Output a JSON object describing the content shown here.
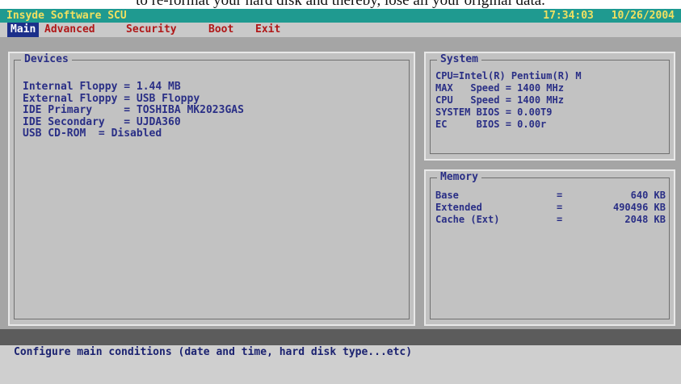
{
  "caption": "to re-format your hard disk and thereby, lose all your original data.",
  "title_bar": {
    "app_name": "Insyde Software SCU",
    "time": "17:34:03",
    "date": "10/26/2004"
  },
  "menu": [
    {
      "label": "Main",
      "active": true
    },
    {
      "label": "Advanced",
      "active": false
    },
    {
      "label": "Security",
      "active": false
    },
    {
      "label": "Boot",
      "active": false
    },
    {
      "label": "Exit",
      "active": false
    }
  ],
  "devices": {
    "title": "Devices",
    "rows": [
      "Internal Floppy = 1.44 MB",
      "External Floppy = USB Floppy",
      "IDE Primary     = TOSHIBA MK2023GAS",
      "IDE Secondary   = UJDA360",
      "USB CD-ROM  = Disabled"
    ]
  },
  "system": {
    "title": "System",
    "rows": [
      "CPU=Intel(R) Pentium(R) M",
      "MAX   Speed = 1400 MHz",
      "CPU   Speed = 1400 MHz",
      "SYSTEM BIOS = 0.00T9",
      "EC     BIOS = 0.00r"
    ]
  },
  "memory": {
    "title": "Memory",
    "rows": [
      {
        "label": "Base",
        "value": "640 KB"
      },
      {
        "label": "Extended",
        "value": "490496 KB"
      },
      {
        "label": "Cache (Ext)",
        "value": "2048 KB"
      }
    ]
  },
  "status": {
    "message": "Configure main conditions (date and time, hard disk type...etc)"
  },
  "colors": {
    "title_bar_bg": "#1f9a90",
    "menu_active_bg": "#1b2f8a",
    "menu_text": "#b01818",
    "panel_text": "#2a2f86"
  }
}
